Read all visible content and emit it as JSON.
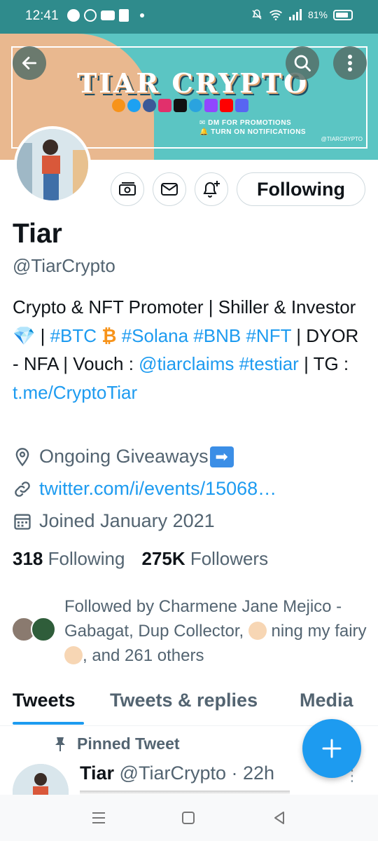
{
  "status_bar": {
    "time": "12:41",
    "battery": "81%"
  },
  "banner": {
    "title": "TIAR CRYPTO",
    "line1": "DM FOR PROMOTIONS",
    "line2": "TURN ON NOTIFICATIONS",
    "tag": "@TIARCRYPTO",
    "social_colors": [
      "#f7931a",
      "#1da1f2",
      "#3b5998",
      "#e1306c",
      "#111111",
      "#2aa3df",
      "#9146ff",
      "#ff0000",
      "#5865f2"
    ]
  },
  "profile": {
    "name": "Tiar",
    "handle": "@TiarCrypto",
    "following_button": "Following",
    "bio": {
      "t1": "Crypto & NFT Promoter | Shiller & Investor 💎 | ",
      "h1": "#BTC",
      "t2": " ₿  ",
      "h2": "#Solana #BNB #NFT",
      "t3": " | DYOR - NFA | Vouch : ",
      "h3": "@tiarclaims #testiar",
      "t4": " | TG : ",
      "h4": "t.me/CryptoTiar"
    },
    "location": "Ongoing Giveaways",
    "location_emoji": "➡",
    "website": "twitter.com/i/events/15068…",
    "joined": "Joined January 2021",
    "following_count": "318",
    "following_label": "Following",
    "followers_count": "275K",
    "followers_label": "Followers",
    "followed_by_1": "Followed by Charmene Jane Mejico - Gabagat, Dup Collector, ",
    "followed_by_2": " ning my fairy ",
    "followed_by_3": ", and 261 others"
  },
  "tabs": [
    {
      "label": "Tweets"
    },
    {
      "label": "Tweets & replies"
    },
    {
      "label": "Media"
    }
  ],
  "pinned": {
    "label": "Pinned Tweet",
    "name": "Tiar",
    "handle": "@TiarCrypto",
    "time": "· 22h"
  },
  "colors": {
    "accent": "#1d9bf0",
    "status_bar": "#2f8b8c"
  }
}
